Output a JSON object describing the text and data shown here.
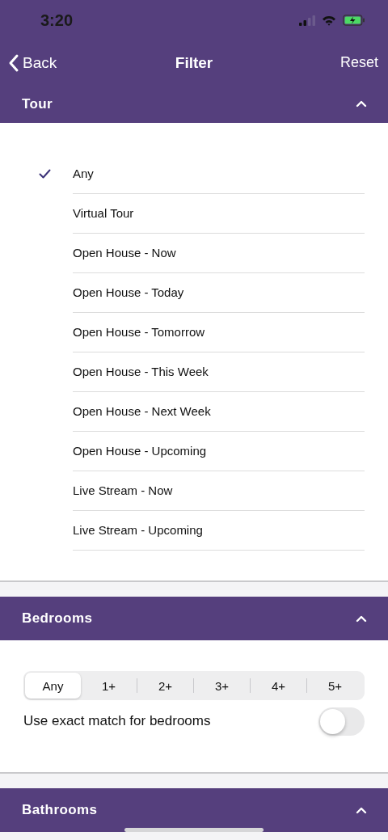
{
  "status_bar": {
    "time": "3:20"
  },
  "nav": {
    "back": "Back",
    "title": "Filter",
    "action": "Reset"
  },
  "sections": [
    {
      "kind": "list",
      "title": "Tour",
      "expanded": true,
      "options": [
        {
          "label": "Any",
          "selected": true
        },
        {
          "label": "Virtual Tour",
          "selected": false
        },
        {
          "label": "Open House - Now",
          "selected": false
        },
        {
          "label": "Open House - Today",
          "selected": false
        },
        {
          "label": "Open House - Tomorrow",
          "selected": false
        },
        {
          "label": "Open House - This Week",
          "selected": false
        },
        {
          "label": "Open House - Next Week",
          "selected": false
        },
        {
          "label": "Open House - Upcoming",
          "selected": false
        },
        {
          "label": "Live Stream - Now",
          "selected": false
        },
        {
          "label": "Live Stream - Upcoming",
          "selected": false
        }
      ]
    },
    {
      "kind": "segments",
      "title": "Bedrooms",
      "expanded": true,
      "options": [
        {
          "label": "Any",
          "selected": true
        },
        {
          "label": "1+",
          "selected": false
        },
        {
          "label": "2+",
          "selected": false
        },
        {
          "label": "3+",
          "selected": false
        },
        {
          "label": "4+",
          "selected": false
        },
        {
          "label": "5+",
          "selected": false
        }
      ],
      "toggle": {
        "label": "Use exact match for bedrooms",
        "on": false
      }
    },
    {
      "kind": "collapsed",
      "title": "Bathrooms",
      "expanded": true
    }
  ]
}
